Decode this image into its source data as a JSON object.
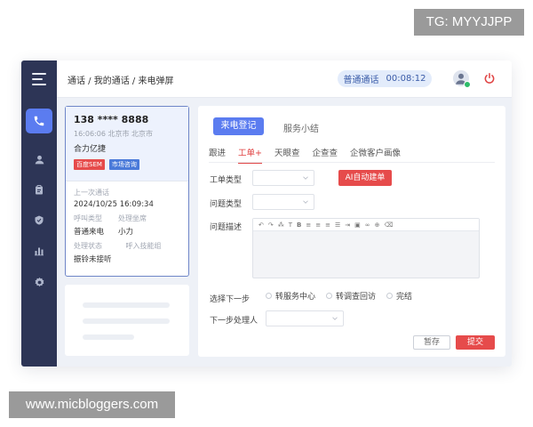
{
  "watermark_top": "TG: MYYJJPP",
  "watermark_bottom": "www.micbloggers.com",
  "header": {
    "breadcrumb": "通话 / 我的通话 / 来电弹屏",
    "call_type": "普通通话",
    "call_duration": "00:08:12"
  },
  "caller": {
    "number": "138 **** 8888",
    "time_location": "16:06:06  北京市 北京市",
    "company": "合力亿捷",
    "tags": [
      "百度SEM",
      "市场咨询"
    ],
    "last_call_label": "上一次通话",
    "last_call_value": "2024/10/25  16:09:34",
    "call_type_label": "呼叫类型",
    "call_type_value": "普通来电",
    "handler_label": "处理坐席",
    "handler_value": "小力",
    "status_label": "处理状态",
    "status_value": "振铃未接听",
    "skill_label": "呼入技能组"
  },
  "form": {
    "tab_active": "来电登记",
    "tab_other": "服务小结",
    "subtabs": [
      "跟进",
      "工单+",
      "天眼查",
      "企查查",
      "企微客户画像"
    ],
    "ticket_type_label": "工单类型",
    "issue_type_label": "问题类型",
    "ai_button": "AI自动建单",
    "desc_label": "问题描述",
    "next_step_label": "选择下一步",
    "next_step_options": [
      "转服务中心",
      "转调查回访",
      "完结"
    ],
    "next_handler_label": "下一步处理人",
    "save_button": "暂存",
    "submit_button": "提交"
  },
  "colors": {
    "accent": "#5b7cf0",
    "rail": "#2d3556",
    "danger": "#e64b4b"
  }
}
